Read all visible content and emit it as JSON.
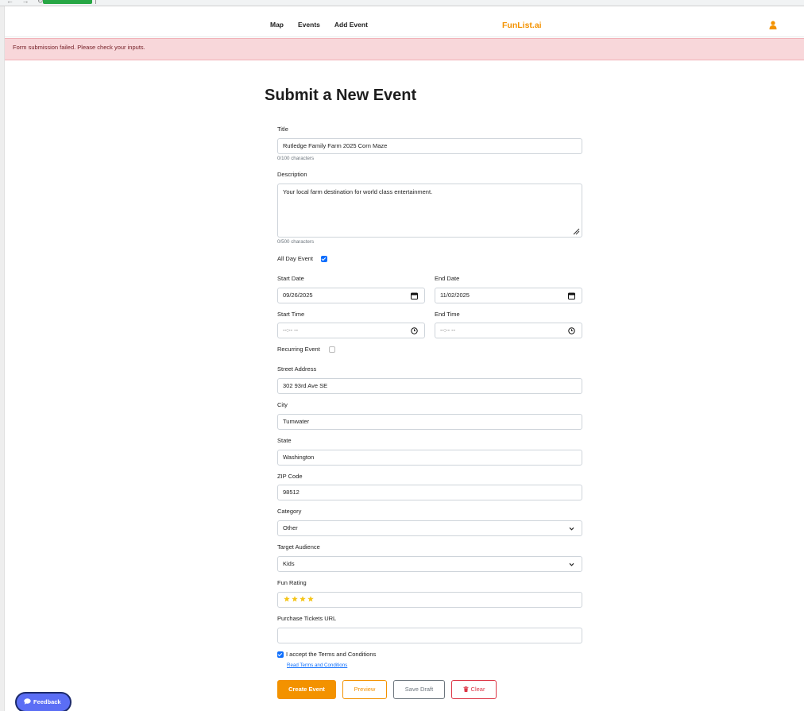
{
  "nav": {
    "links": [
      "Map",
      "Events",
      "Add Event"
    ],
    "brand": "FunList.ai",
    "brand_color": "#f39200"
  },
  "alert": {
    "message": "Form submission failed. Please check your inputs."
  },
  "page_title": "Submit a New Event",
  "form": {
    "title_label": "Title",
    "title_value": "Rutledge Family Farm 2025 Corn Maze",
    "title_counter": "0/100 characters",
    "description_label": "Description",
    "description_value": "Your local farm destination for world class entertainment.",
    "description_counter": "0/500 characters",
    "all_day_label": "All Day Event",
    "all_day_checked": true,
    "start_date_label": "Start Date",
    "start_date_value": "09/26/2025",
    "end_date_label": "End Date",
    "end_date_value": "11/02/2025",
    "start_time_label": "Start Time",
    "start_time_placeholder": "--:-- --",
    "end_time_label": "End Time",
    "end_time_placeholder": "--:-- --",
    "recurring_label": "Recurring Event",
    "recurring_checked": false,
    "street_label": "Street Address",
    "street_value": "302 93rd Ave SE",
    "city_label": "City",
    "city_value": "Tumwater",
    "state_label": "State",
    "state_value": "Washington",
    "zip_label": "ZIP Code",
    "zip_value": "98512",
    "category_label": "Category",
    "category_value": "Other",
    "audience_label": "Target Audience",
    "audience_value": "Kids",
    "fun_rating_label": "Fun Rating",
    "fun_rating_value": 4,
    "tickets_label": "Purchase Tickets URL",
    "tickets_value": "",
    "terms_label": "I accept the Terms and Conditions",
    "terms_checked": true,
    "terms_link": "Read Terms and Conditions"
  },
  "buttons": {
    "create": "Create Event",
    "preview": "Preview",
    "save_draft": "Save Draft",
    "clear": "Clear"
  },
  "feedback_label": "Feedback",
  "icons": {
    "user": "user-icon",
    "calendar": "calendar-icon",
    "clock": "clock-icon",
    "chevron": "chevron-down-icon",
    "star": "star-icon",
    "trash": "trash-icon",
    "chat": "chat-bubble-icon"
  },
  "colors": {
    "accent": "#f39200",
    "primary": "#0d6efd",
    "danger": "#dc3545",
    "alert_bg": "#f8d7da",
    "star": "#f5c518"
  }
}
